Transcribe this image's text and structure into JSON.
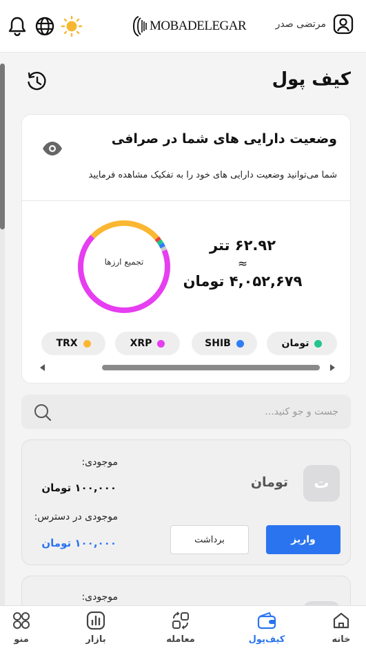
{
  "header": {
    "logo_text": "MOBADELEGAR",
    "user_name": "مرتضی صدر"
  },
  "page": {
    "title": "کیف پول"
  },
  "summary": {
    "title": "وضعیت دارایی های شما در صرافی",
    "description": "شما می‌توانید وضعیت دارایی های خود را به تفکیک مشاهده فرمایید",
    "donut_label": "تجمیع ارزها",
    "amount_tether": "۶۲.۹۲ تتر",
    "approx_sign": "≈",
    "amount_toman": "۴,۰۵۲,۶۷۹ تومان",
    "donut": {
      "segments": [
        {
          "name": "XRP",
          "fraction": 0.682,
          "color": "#e63ef0"
        },
        {
          "name": "TRX",
          "fraction": 0.265,
          "color": "#fbb731"
        },
        {
          "name": "red",
          "fraction": 0.012,
          "color": "#ef3b3b"
        },
        {
          "name": "تومان",
          "fraction": 0.014,
          "color": "#22c58b"
        },
        {
          "name": "SHIB",
          "fraction": 0.014,
          "color": "#2f7df6"
        },
        {
          "name": "gray",
          "fraction": 0.013,
          "color": "#c9c9c9"
        }
      ]
    },
    "chips": [
      {
        "label": "تومان",
        "color": "#22c58b"
      },
      {
        "label": "SHIB",
        "color": "#2f7df6"
      },
      {
        "label": "XRP",
        "color": "#e63ef0"
      },
      {
        "label": "TRX",
        "color": "#fbb731"
      }
    ]
  },
  "search": {
    "placeholder": "جست و جو کنید..."
  },
  "wallets": [
    {
      "coin_name": "تومان",
      "coin_symbol": "ت",
      "balance_label": "موجودی:",
      "balance_value": "۱۰۰,۰۰۰ تومان",
      "available_label": "موجودی در دسترس:",
      "available_value": "۱۰۰,۰۰۰ تومان",
      "deposit_label": "واریز",
      "withdraw_label": "برداشت"
    },
    {
      "balance_label": "موجودی:"
    }
  ],
  "bottom_nav": [
    {
      "label": "خانه"
    },
    {
      "label": "کیف‌پول"
    },
    {
      "label": "معامله"
    },
    {
      "label": "بازار"
    },
    {
      "label": "منو"
    }
  ],
  "colors": {
    "accent": "#2a74f0",
    "positive_value": "#2a74f0",
    "sun": "#f7b731"
  }
}
